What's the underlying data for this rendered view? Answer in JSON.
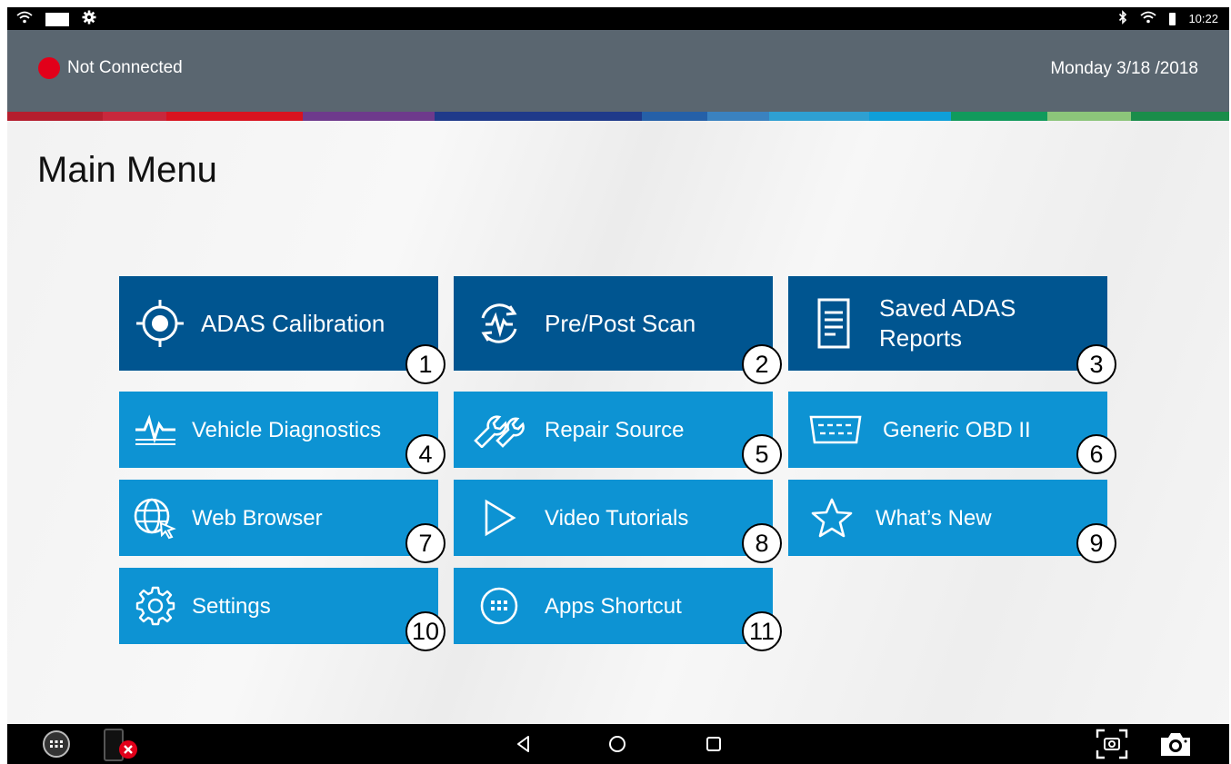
{
  "status_bar": {
    "time": "10:22"
  },
  "header": {
    "connection_status": "Not Connected",
    "date": "Monday 3/18 /2018"
  },
  "page": {
    "title": "Main Menu"
  },
  "tiles": [
    {
      "label": "ADAS Calibration",
      "number": "1",
      "icon": "target-icon"
    },
    {
      "label": "Pre/Post Scan",
      "number": "2",
      "icon": "scan-cycle-icon"
    },
    {
      "label": "Saved ADAS Reports",
      "number": "3",
      "icon": "document-icon"
    },
    {
      "label": "Vehicle Diagnostics",
      "number": "4",
      "icon": "diagnostics-waveform-icon"
    },
    {
      "label": "Repair Source",
      "number": "5",
      "icon": "wrench-icon"
    },
    {
      "label": "Generic OBD II",
      "number": "6",
      "icon": "obd-connector-icon"
    },
    {
      "label": "Web Browser",
      "number": "7",
      "icon": "globe-cursor-icon"
    },
    {
      "label": "Video Tutorials",
      "number": "8",
      "icon": "play-icon"
    },
    {
      "label": "What’s New",
      "number": "9",
      "icon": "star-icon"
    },
    {
      "label": "Settings",
      "number": "10",
      "icon": "gear-icon"
    },
    {
      "label": "Apps Shortcut",
      "number": "11",
      "icon": "apps-grid-icon"
    }
  ],
  "colors": {
    "header_bg": "#5a6670",
    "tile_dark": "#005590",
    "tile_light": "#0d93d3",
    "not_connected": "#e2001a"
  }
}
